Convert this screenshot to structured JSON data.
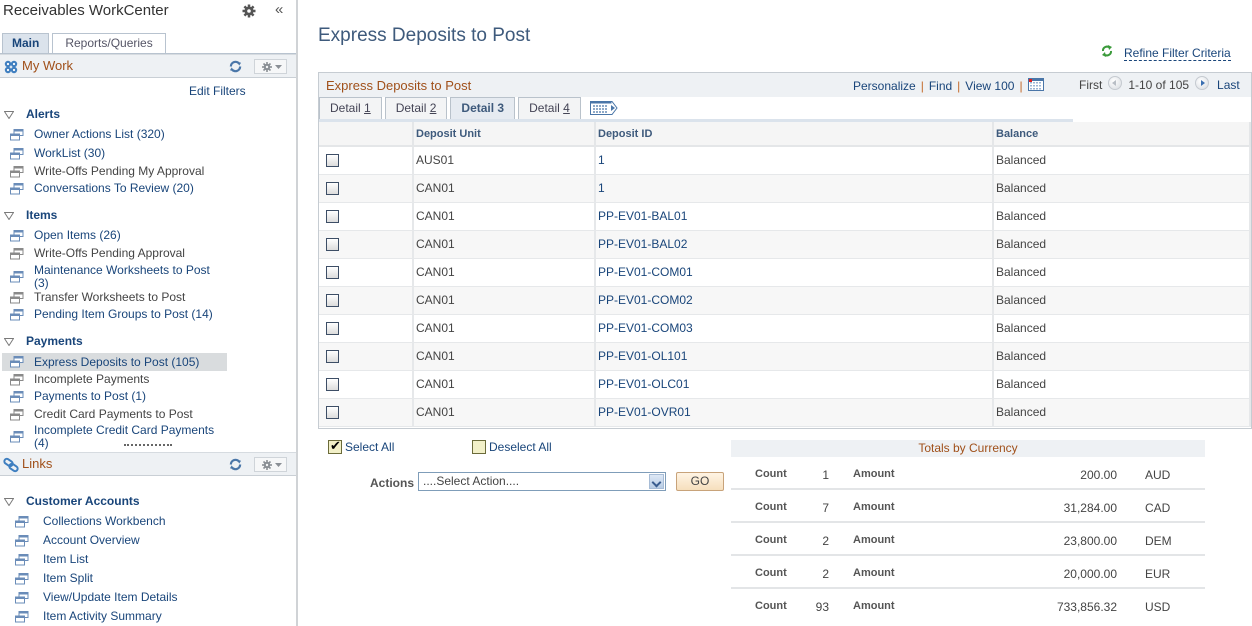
{
  "workcenter": {
    "title": "Receivables WorkCenter",
    "tabs": [
      {
        "label": "Main",
        "active": true
      },
      {
        "label": "Reports/Queries",
        "active": false
      }
    ]
  },
  "my_work": {
    "title": "My Work",
    "edit_filters": "Edit Filters",
    "groups": [
      {
        "label": "Alerts",
        "items": [
          {
            "label": "Owner Actions List (320)",
            "enabled": true
          },
          {
            "label": "WorkList (30)",
            "enabled": true
          },
          {
            "label": "Write-Offs Pending My Approval",
            "enabled": false
          },
          {
            "label": "Conversations To Review (20)",
            "enabled": true
          }
        ]
      },
      {
        "label": "Items",
        "items": [
          {
            "label": "Open Items (26)",
            "enabled": true
          },
          {
            "label": "Write-Offs Pending Approval",
            "enabled": false
          },
          {
            "label": "Maintenance Worksheets to Post (3)",
            "enabled": true
          },
          {
            "label": "Transfer Worksheets to Post",
            "enabled": false
          },
          {
            "label": "Pending Item Groups to Post (14)",
            "enabled": true
          }
        ]
      },
      {
        "label": "Payments",
        "items": [
          {
            "label": "Express Deposits to Post (105)",
            "enabled": true,
            "selected": true
          },
          {
            "label": "Incomplete Payments",
            "enabled": false
          },
          {
            "label": "Payments to Post (1)",
            "enabled": true
          },
          {
            "label": "Credit Card Payments to Post",
            "enabled": false
          },
          {
            "label": "Incomplete Credit Card Payments (4)",
            "enabled": true
          }
        ]
      }
    ]
  },
  "links": {
    "title": "Links",
    "groups": [
      {
        "label": "Customer Accounts",
        "items": [
          {
            "label": "Collections Workbench"
          },
          {
            "label": "Account Overview"
          },
          {
            "label": "Item List"
          },
          {
            "label": "Item Split"
          },
          {
            "label": "View/Update Item Details"
          },
          {
            "label": "Item Activity Summary"
          }
        ]
      }
    ]
  },
  "main": {
    "page_title": "Express Deposits to Post",
    "refine_filter": "Refine Filter Criteria",
    "grid": {
      "title": "Express Deposits to Post",
      "personalize": "Personalize",
      "find": "Find",
      "view_all": "View 100",
      "pager": {
        "first": "First",
        "range": "1-10 of 105",
        "last": "Last"
      },
      "tabs": [
        {
          "prefix": "Detail ",
          "key": "1",
          "active": false
        },
        {
          "prefix": "Detail ",
          "key": "2",
          "active": false
        },
        {
          "prefix": "Detail ",
          "key": "3",
          "active": true
        },
        {
          "prefix": "Detail ",
          "key": "4",
          "active": false
        }
      ],
      "columns": [
        "",
        "Deposit Unit",
        "Deposit ID",
        "Balance"
      ],
      "rows": [
        {
          "checked": false,
          "unit": "AUS01",
          "id": "1",
          "balance": "Balanced"
        },
        {
          "checked": false,
          "unit": "CAN01",
          "id": "1",
          "balance": "Balanced"
        },
        {
          "checked": false,
          "unit": "CAN01",
          "id": "PP-EV01-BAL01",
          "balance": "Balanced"
        },
        {
          "checked": false,
          "unit": "CAN01",
          "id": "PP-EV01-BAL02",
          "balance": "Balanced"
        },
        {
          "checked": false,
          "unit": "CAN01",
          "id": "PP-EV01-COM01",
          "balance": "Balanced"
        },
        {
          "checked": false,
          "unit": "CAN01",
          "id": "PP-EV01-COM02",
          "balance": "Balanced"
        },
        {
          "checked": false,
          "unit": "CAN01",
          "id": "PP-EV01-COM03",
          "balance": "Balanced"
        },
        {
          "checked": false,
          "unit": "CAN01",
          "id": "PP-EV01-OL101",
          "balance": "Balanced"
        },
        {
          "checked": false,
          "unit": "CAN01",
          "id": "PP-EV01-OLC01",
          "balance": "Balanced"
        },
        {
          "checked": false,
          "unit": "CAN01",
          "id": "PP-EV01-OVR01",
          "balance": "Balanced"
        }
      ]
    },
    "select_all": "Select All",
    "deselect_all": "Deselect All",
    "actions_label": "Actions",
    "actions_value": "....Select Action....",
    "go_label": "GO",
    "totals": {
      "title": "Totals by Currency",
      "count_label": "Count",
      "amount_label": "Amount",
      "rows": [
        {
          "count": "1",
          "amount": "200.00",
          "currency": "AUD"
        },
        {
          "count": "7",
          "amount": "31,284.00",
          "currency": "CAD"
        },
        {
          "count": "2",
          "amount": "23,800.00",
          "currency": "DEM"
        },
        {
          "count": "2",
          "amount": "20,000.00",
          "currency": "EUR"
        },
        {
          "count": "93",
          "amount": "733,856.32",
          "currency": "USD"
        }
      ]
    }
  },
  "colors": {
    "link": "#19457a",
    "section_title": "#a0501a",
    "page_title": "#3e5a7c"
  }
}
